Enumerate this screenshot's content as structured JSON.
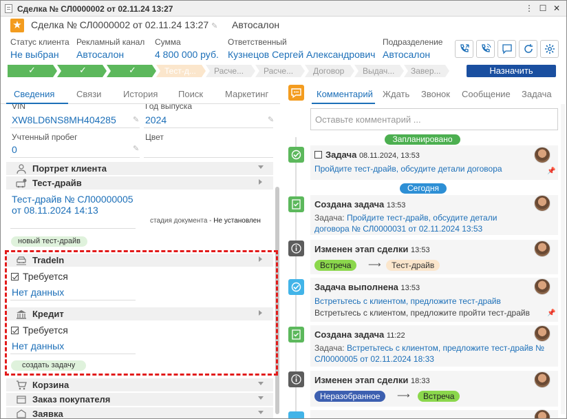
{
  "window": {
    "title": "Сделка № СЛ0000002 от 02.11.24 13:27",
    "header_title": "Сделка № СЛ0000002 от 02.11.24 13:27",
    "header_sub": "Автосалон"
  },
  "summary": {
    "status_label": "Статус клиента",
    "status_value": "Не выбран",
    "channel_label": "Рекламный канал",
    "channel_value": "Автосалон",
    "sum_label": "Сумма",
    "sum_value": "4 800 000 руб.",
    "resp_label": "Ответственный",
    "resp_value": "Кузнецов Сергей Александрович",
    "unit_label": "Подразделение",
    "unit_value": "Автосалон"
  },
  "stages": [
    {
      "label": "",
      "state": "done"
    },
    {
      "label": "",
      "state": "done"
    },
    {
      "label": "",
      "state": "done"
    },
    {
      "label": "Тест-д...",
      "state": "current"
    },
    {
      "label": "Расче...",
      "state": "todo"
    },
    {
      "label": "Расче...",
      "state": "todo"
    },
    {
      "label": "Договор",
      "state": "todo"
    },
    {
      "label": "Выдач...",
      "state": "todo"
    },
    {
      "label": "Завер...",
      "state": "todo"
    }
  ],
  "assign_button": "Назначить",
  "left_tabs": [
    "Сведения",
    "Связи",
    "История",
    "Поиск",
    "Маркетинг"
  ],
  "fields": {
    "vin_label": "VIN",
    "vin_value": "XW8LD6NS8MH404285",
    "year_label": "Год выпуска",
    "year_value": "2024",
    "mileage_label": "Учтенный пробег",
    "mileage_value": "0",
    "color_label": "Цвет",
    "color_value": ""
  },
  "sections": {
    "portrait": "Портрет клиента",
    "testdrive": "Тест-драйв",
    "tradein": "TradeIn",
    "credit": "Кредит",
    "cart": "Корзина",
    "order": "Заказ покупателя",
    "request": "Заявка"
  },
  "testdrive": {
    "doc_link": "Тест-драйв № СЛ00000005 от 08.11.2024 14:13",
    "doc_stage_label": "стадия документа -",
    "doc_stage_value": "Не установлен",
    "new_badge": "новый тест-драйв"
  },
  "tradein": {
    "required_label": "Требуется",
    "required_checked": true,
    "nodata": "Нет данных"
  },
  "credit": {
    "required_label": "Требуется",
    "required_checked": true,
    "nodata": "Нет данных",
    "task_badge": "создать задачу"
  },
  "right_tabs": [
    "Комментарий",
    "Ждать",
    "Звонок",
    "Сообщение",
    "Задача"
  ],
  "comment_placeholder": "Оставьте комментарий ...",
  "timeline": {
    "planned_label": "Запланировано",
    "today_label": "Сегодня",
    "items": [
      {
        "title": "Задача",
        "time": "08.11.2024, 13:53",
        "text": "Пройдите тест-драйв, обсудите детали договора"
      },
      {
        "title": "Создана задача",
        "time": "13:53",
        "prefix": "Задача:",
        "text": "Пройдите тест-драйв, обсудите детали договора № СЛ0000031 от 02.11.2024 13:53"
      },
      {
        "title": "Изменен этап сделки",
        "time": "13:53",
        "from": "Встреча",
        "to": "Тест-драйв"
      },
      {
        "title": "Задача выполнена",
        "time": "13:53",
        "text": "Встретьтесь с клиентом, предложите тест-драйв",
        "text2": "Встретьтесь с клиентом, предложите пройти тест-драйв"
      },
      {
        "title": "Создана задача",
        "time": "11:22",
        "prefix": "Задача:",
        "text": "Встретьтесь с клиентом, предложите тест-драйв № СЛ0000005 от 02.11.2024 18:33"
      },
      {
        "title": "Изменен этап сделки",
        "time": "18:33",
        "from": "Неразобранное",
        "to": "Встреча"
      }
    ]
  },
  "colors": {
    "accent": "#1c6fb8",
    "stage_done": "#5cb85c",
    "assign_button": "#1a4fa0",
    "planned_pill": "#4caf50",
    "today_pill": "#2d8fd5",
    "highlight_border": "#e21b1b"
  }
}
